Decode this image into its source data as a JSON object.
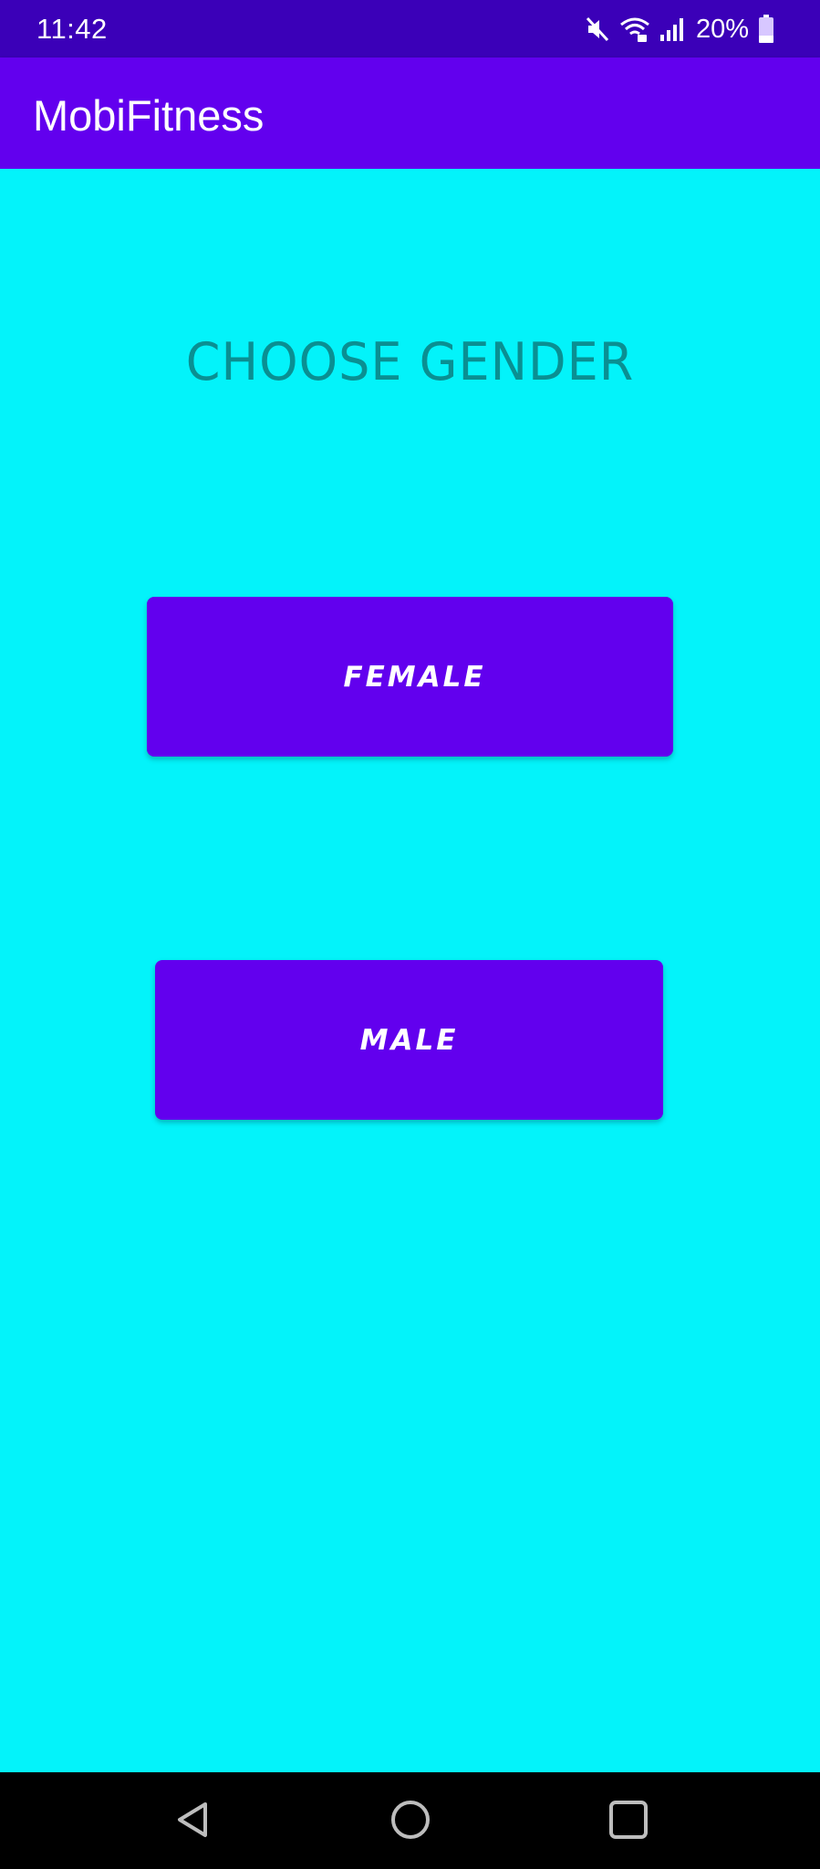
{
  "status_bar": {
    "time": "11:42",
    "battery": "20%",
    "icons": [
      "mute-icon",
      "wifi-icon",
      "signal-icon",
      "battery-icon"
    ]
  },
  "app_bar": {
    "title": "MobiFitness"
  },
  "main": {
    "heading": "CHOOSE GENDER",
    "female_label": "FEMALE",
    "male_label": "MALE"
  },
  "nav_bar": {
    "icons": [
      "back-icon",
      "home-icon",
      "recents-icon"
    ]
  },
  "colors": {
    "status_bar": "#3b00b8",
    "app_bar": "#6200ee",
    "background": "#03f3fa",
    "heading_text": "#0a8f92",
    "button": "#6200ee",
    "button_text": "#ffffff"
  }
}
